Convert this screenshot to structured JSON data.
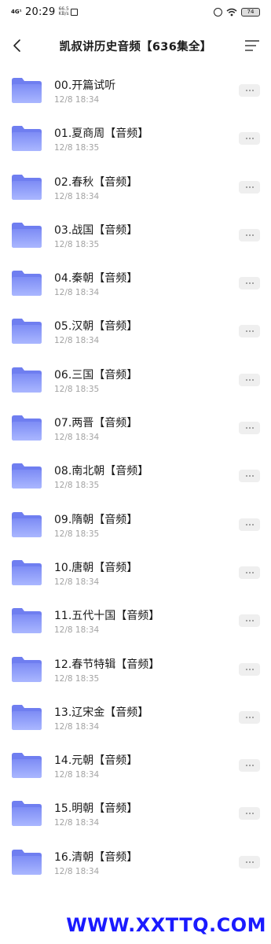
{
  "status_bar": {
    "network": "4G¹",
    "time": "20:29",
    "speed": "66.5 KB/s",
    "battery": "74"
  },
  "header": {
    "title": "凯叔讲历史音频【636集全】",
    "icons": {
      "back": "chevron-left-icon",
      "menu": "list-menu-icon"
    }
  },
  "items": [
    {
      "name": "00.开篇试听",
      "date": "12/8 18:34"
    },
    {
      "name": "01.夏商周【音频】",
      "date": "12/8 18:35"
    },
    {
      "name": "02.春秋【音频】",
      "date": "12/8 18:34"
    },
    {
      "name": "03.战国【音频】",
      "date": "12/8 18:35"
    },
    {
      "name": "04.秦朝【音频】",
      "date": "12/8 18:34"
    },
    {
      "name": "05.汉朝【音频】",
      "date": "12/8 18:34"
    },
    {
      "name": "06.三国【音频】",
      "date": "12/8 18:35"
    },
    {
      "name": "07.两晋【音频】",
      "date": "12/8 18:34"
    },
    {
      "name": "08.南北朝【音频】",
      "date": "12/8 18:35"
    },
    {
      "name": "09.隋朝【音频】",
      "date": "12/8 18:35"
    },
    {
      "name": "10.唐朝【音频】",
      "date": "12/8 18:34"
    },
    {
      "name": "11.五代十国【音频】",
      "date": "12/8 18:34"
    },
    {
      "name": "12.春节特辑【音频】",
      "date": "12/8 18:35"
    },
    {
      "name": "13.辽宋金【音频】",
      "date": "12/8 18:34"
    },
    {
      "name": "14.元朝【音频】",
      "date": "12/8 18:34"
    },
    {
      "name": "15.明朝【音频】",
      "date": "12/8 18:34"
    },
    {
      "name": "16.清朝【音频】",
      "date": "12/8 18:34"
    }
  ],
  "watermark": "WWW.XXTTQ.COM",
  "colors": {
    "folder_top": "#7d8cf5",
    "folder_bottom": "#aab7ff",
    "watermark": "#1a1aff"
  }
}
